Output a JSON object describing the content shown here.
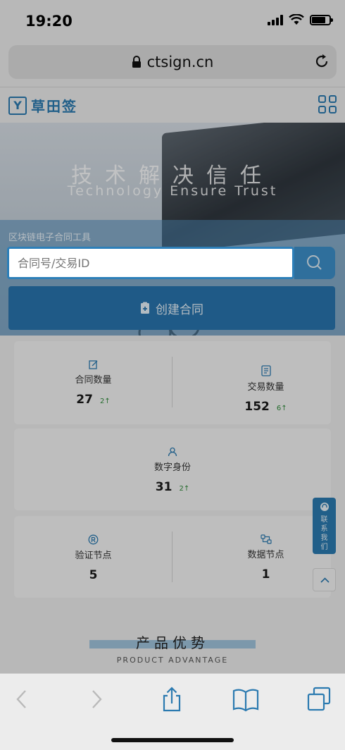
{
  "status_bar": {
    "time": "19:20"
  },
  "browser": {
    "url": "ctsign.cn"
  },
  "site": {
    "logo_text": "草田签",
    "logo_mark": "Y"
  },
  "hero": {
    "title_cn": "技术解决信任",
    "title_en": "Technology Ensure Trust",
    "tool_label": "区块链电子合同工具",
    "search_placeholder": "合同号/交易ID",
    "create_button": "创建合同"
  },
  "stats": {
    "contracts": {
      "label": "合同数量",
      "value": "27",
      "delta": "2↑"
    },
    "transactions": {
      "label": "交易数量",
      "value": "152",
      "delta": "6↑"
    },
    "identities": {
      "label": "数字身份",
      "value": "31",
      "delta": "2↑"
    },
    "verify_nodes": {
      "label": "验证节点",
      "value": "5"
    },
    "data_nodes": {
      "label": "数据节点",
      "value": "1"
    }
  },
  "floating": {
    "contact_label": "联系我们"
  },
  "advantage": {
    "title": "产品优势",
    "subtitle": "PRODUCT ADVANTAGE"
  },
  "colors": {
    "brand": "#2b7ab0",
    "positive": "#2f8a3a"
  }
}
